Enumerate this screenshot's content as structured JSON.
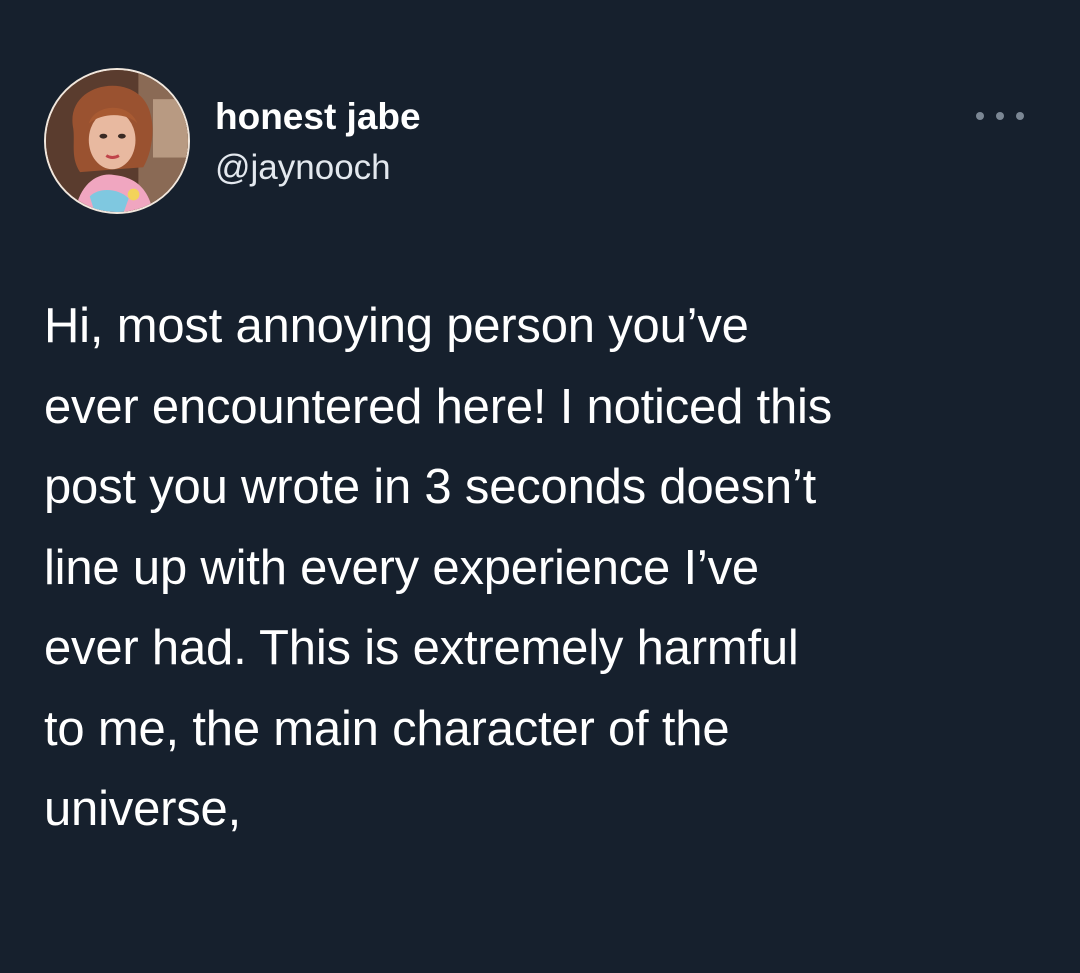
{
  "tweet": {
    "author": {
      "display_name": "honest jabe",
      "handle": "@jaynooch",
      "avatar_icon": "profile-photo"
    },
    "more_icon": "more-horizontal-icon",
    "lines": [
      "Hi, most annoying person you’ve",
      "ever encountered here! I noticed this",
      "post you wrote in 3 seconds doesn’t",
      "line up with every experience I’ve",
      "ever had. This is extremely harmful",
      "to me, the main character of the",
      "universe,"
    ]
  },
  "colors": {
    "background": "#16202d",
    "text": "#ffffff",
    "secondary_text": "#e3e8ee",
    "icon_muted": "#7b8794"
  }
}
